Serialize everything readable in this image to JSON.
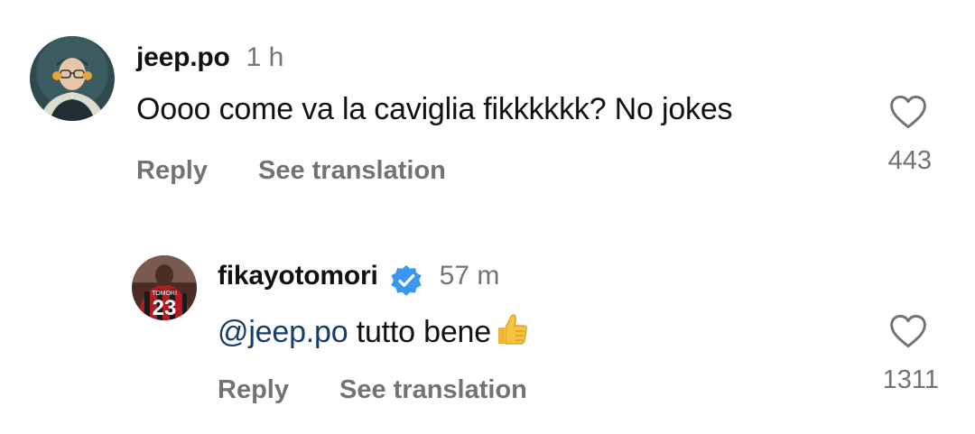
{
  "comments": [
    {
      "username": "jeep.po",
      "time": "1 h",
      "text": "Oooo come va la caviglia fikkkkkk? No jokes",
      "reply_label": "Reply",
      "translate_label": "See translation",
      "likes": "443",
      "avatar_icon": "avatar-photo-icon",
      "like_icon": "heart-outline-icon"
    },
    {
      "username": "fikayotomori",
      "verified": true,
      "verified_icon": "verified-badge-icon",
      "time": "57 m",
      "mention": "@jeep.po",
      "text": " tutto bene",
      "emoji_icon": "thumbs-up-emoji-icon",
      "reply_label": "Reply",
      "translate_label": "See translation",
      "likes": "1311",
      "avatar_icon": "avatar-photo-icon",
      "like_icon": "heart-outline-icon"
    }
  ],
  "colors": {
    "text": "#111111",
    "secondary": "#737373",
    "mention": "#1a3b6e",
    "verified": "#3897f0"
  }
}
